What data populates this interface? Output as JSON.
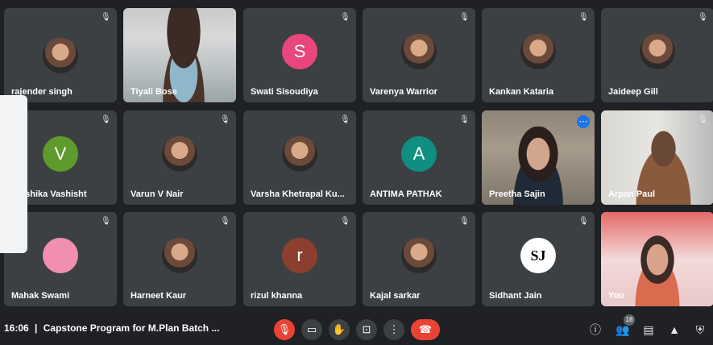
{
  "meeting": {
    "time": "16:06",
    "separator": "|",
    "title": "Capstone Program for M.Plan Batch ..."
  },
  "participants": [
    {
      "name": "rajender singh",
      "initial": "",
      "avatar_color": "",
      "type": "photo"
    },
    {
      "name": "Tiyali Bose",
      "initial": "",
      "avatar_color": "",
      "type": "video"
    },
    {
      "name": "Swati Sisoudiya",
      "initial": "S",
      "avatar_color": "#e8467c",
      "type": "initial"
    },
    {
      "name": "Varenya Warrior",
      "initial": "",
      "avatar_color": "",
      "type": "photo"
    },
    {
      "name": "Kankan Kataria",
      "initial": "",
      "avatar_color": "",
      "type": "photo"
    },
    {
      "name": "Jaideep Gill",
      "initial": "",
      "avatar_color": "",
      "type": "photo"
    },
    {
      "name": "Vrashika Vashisht",
      "initial": "V",
      "avatar_color": "#5f9a2c",
      "type": "initial"
    },
    {
      "name": "Varun V Nair",
      "initial": "",
      "avatar_color": "",
      "type": "photo"
    },
    {
      "name": "Varsha Khetrapal Ku...",
      "initial": "",
      "avatar_color": "",
      "type": "photo"
    },
    {
      "name": "ANTIMA PATHAK",
      "initial": "A",
      "avatar_color": "#0f8f7f",
      "type": "initial"
    },
    {
      "name": "Preetha Sajin",
      "initial": "",
      "avatar_color": "",
      "type": "video"
    },
    {
      "name": "Arpan Paul",
      "initial": "",
      "avatar_color": "",
      "type": "video"
    },
    {
      "name": "Mahak Swami",
      "initial": "",
      "avatar_color": "",
      "type": "photo"
    },
    {
      "name": "Harneet Kaur",
      "initial": "",
      "avatar_color": "",
      "type": "photo"
    },
    {
      "name": "rizul khanna",
      "initial": "r",
      "avatar_color": "#8d3f2f",
      "type": "initial"
    },
    {
      "name": "Kajal sarkar",
      "initial": "",
      "avatar_color": "",
      "type": "photo"
    },
    {
      "name": "Sidhant Jain",
      "initial": "",
      "avatar_color": "",
      "type": "photo"
    },
    {
      "name": "You",
      "initial": "",
      "avatar_color": "",
      "type": "video"
    }
  ],
  "participant_count": "18",
  "icons": {
    "mute": "mic-off-icon",
    "mic": "mic-off-icon",
    "camera": "video-camera-icon",
    "hand": "raise-hand-icon",
    "present": "present-screen-icon",
    "more": "more-options-icon",
    "end": "end-call-icon",
    "info": "info-icon",
    "people": "people-icon",
    "chat": "chat-icon",
    "activities": "activities-icon",
    "host": "host-controls-icon"
  },
  "colors": {
    "end_call": "#ea4335",
    "mic_off": "#ea4335",
    "tile_bg": "#3c4043",
    "highlight": "#1a73e8"
  }
}
